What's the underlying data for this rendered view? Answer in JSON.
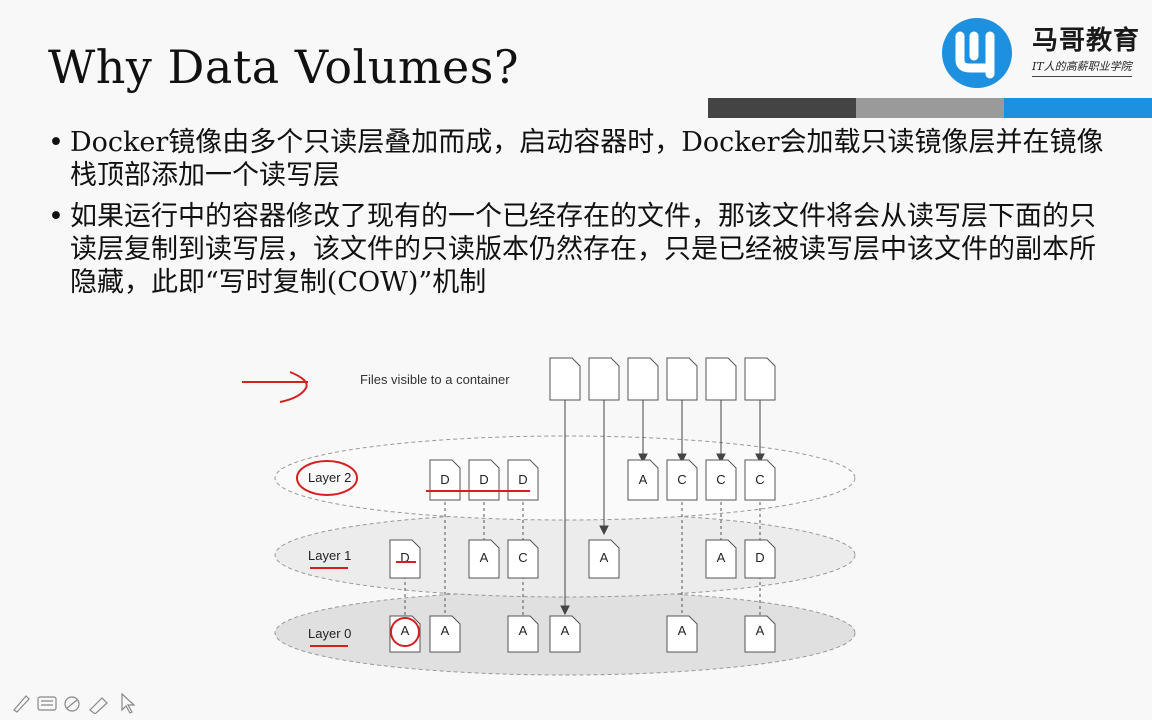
{
  "slide": {
    "title": "Why Data Volumes?",
    "logo_name": "马哥教育",
    "logo_slogan": "IT人的高薪职业学院",
    "bullets": [
      "Docker镜像由多个只读层叠加而成，启动容器时，Docker会加载只读镜像层并在镜像栈顶部添加一个读写层",
      "如果运行中的容器修改了现有的一个已经存在的文件，那该文件将会从读写层下面的只读层复制到读写层，该文件的只读版本仍然存在，只是已经被读写层中该文件的副本所隐藏，此即“写时复制(COW)”机制"
    ],
    "bullet_marker": "•"
  },
  "diagram": {
    "top_label": "Files visible to a container",
    "layers": [
      {
        "name": "Layer 2",
        "files": [
          "D",
          "D",
          "D",
          "A",
          "C",
          "C",
          "C"
        ]
      },
      {
        "name": "Layer 1",
        "files": [
          "D",
          "A",
          "C",
          "A",
          "A",
          "D"
        ]
      },
      {
        "name": "Layer 0",
        "files": [
          "A",
          "A",
          "A",
          "A",
          "A",
          "A"
        ]
      }
    ]
  },
  "colors": {
    "bar_dark": "#444444",
    "bar_mid": "#9a9a9a",
    "bar_blue": "#1e90e0",
    "annotation_red": "#d62020",
    "logo_blue": "#1e90e0"
  },
  "toolbar_icons": [
    "pen-icon",
    "keyboard-icon",
    "eraser-icon",
    "highlighter-icon",
    "pointer-icon"
  ]
}
